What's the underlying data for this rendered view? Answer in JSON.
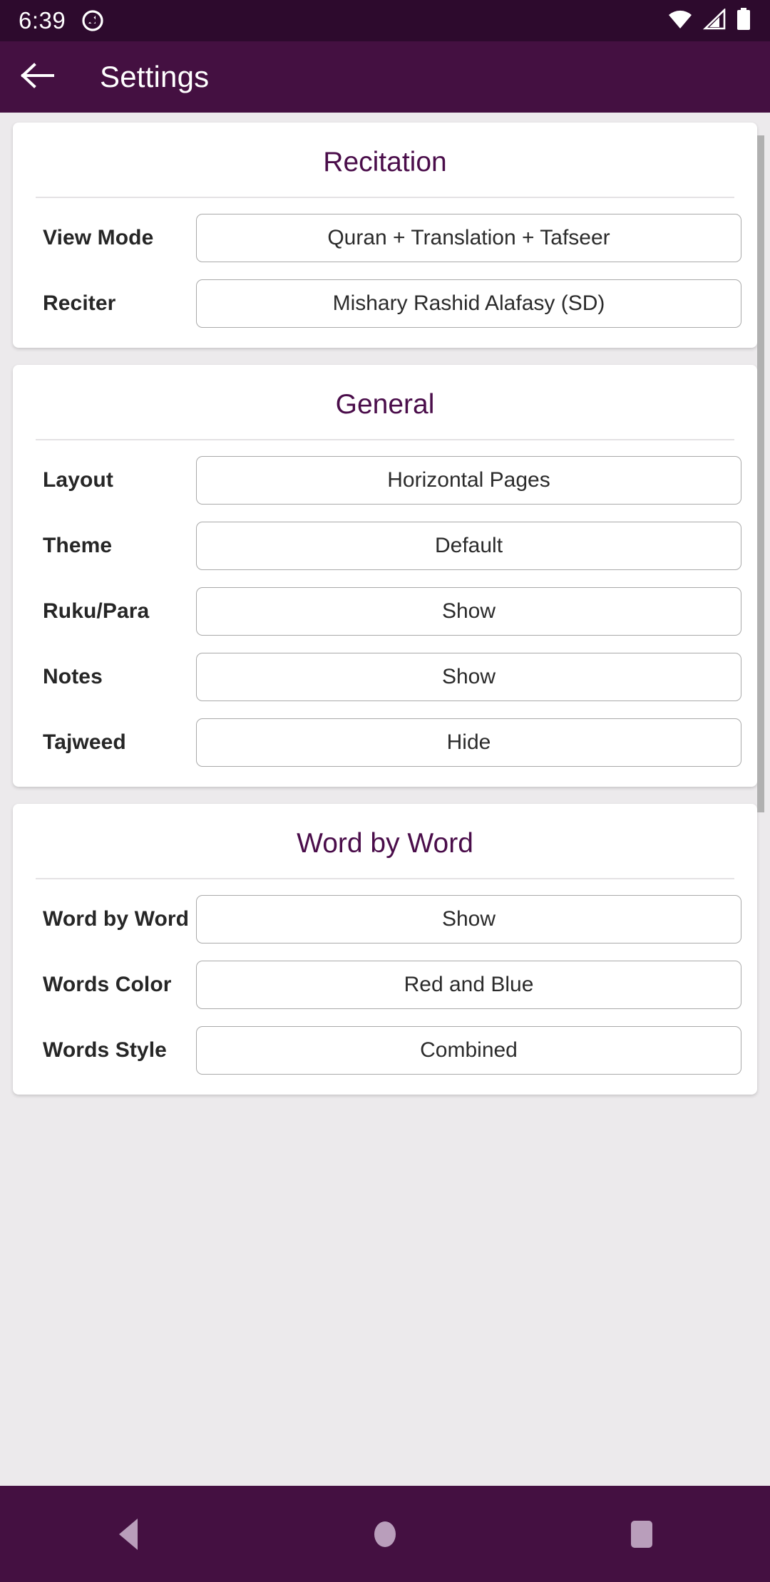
{
  "status_bar": {
    "time": "6:39",
    "icons": [
      "app-notification-icon",
      "wifi-icon",
      "cellular-signal-icon",
      "battery-icon"
    ],
    "background": "#2d0a2d"
  },
  "app_bar": {
    "back_icon": "arrow-left-icon",
    "title": "Settings",
    "background": "#441041",
    "text_color": "#ffffff"
  },
  "theme": {
    "accent": "#4a0d4a",
    "page_background": "#eceaec",
    "card_background": "#ffffff",
    "value_border": "#a9a9a9"
  },
  "sections": [
    {
      "title": "Recitation",
      "rows": [
        {
          "label": "View Mode",
          "value": "Quran + Translation + Tafseer"
        },
        {
          "label": "Reciter",
          "value": "Mishary Rashid Alafasy (SD)"
        }
      ]
    },
    {
      "title": "General",
      "rows": [
        {
          "label": "Layout",
          "value": "Horizontal Pages"
        },
        {
          "label": "Theme",
          "value": "Default"
        },
        {
          "label": "Ruku/Para",
          "value": "Show"
        },
        {
          "label": "Notes",
          "value": "Show"
        },
        {
          "label": "Tajweed",
          "value": "Hide"
        }
      ]
    },
    {
      "title": "Word by Word",
      "rows": [
        {
          "label": "Word by Word",
          "value": "Show"
        },
        {
          "label": "Words Color",
          "value": "Red and Blue"
        },
        {
          "label": "Words Style",
          "value": "Combined"
        }
      ]
    }
  ],
  "nav_bar": {
    "back_label": "back-triangle-icon",
    "home_label": "home-circle-icon",
    "recents_label": "recents-square-icon",
    "background": "#441041"
  }
}
